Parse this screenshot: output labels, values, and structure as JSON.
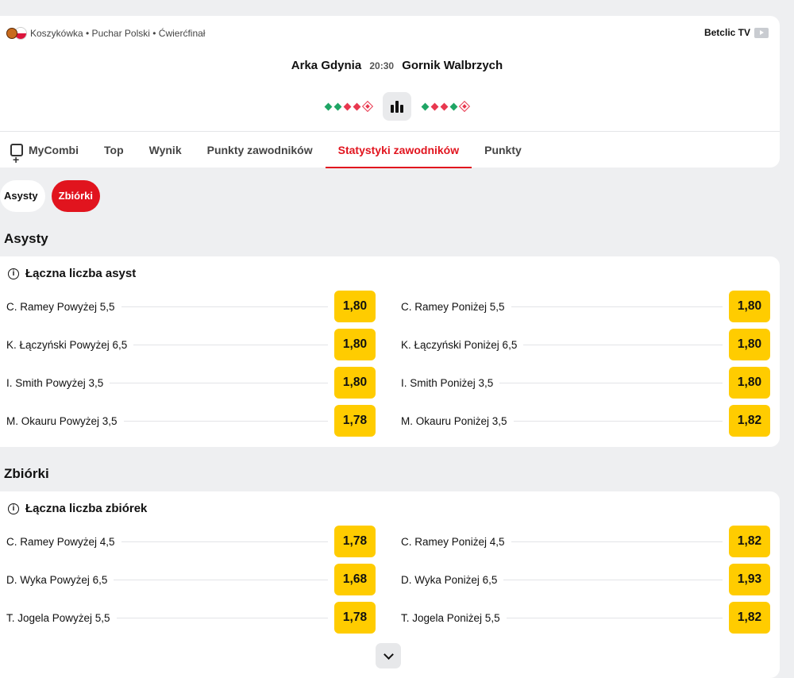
{
  "header": {
    "breadcrumb": "Koszykówka • Puchar Polski • Ćwierćfinał",
    "tv_label": "Betclic TV",
    "home_team": "Arka Gdynia",
    "time": "20:30",
    "away_team": "Gornik Walbrzych",
    "home_form": [
      "win",
      "win",
      "loss",
      "loss",
      "loss"
    ],
    "away_form": [
      "win",
      "loss",
      "loss",
      "win",
      "loss"
    ],
    "colors": {
      "win": "#1fa565",
      "loss": "#e8384f",
      "accent": "#e1141e",
      "odds": "#ffcc00"
    }
  },
  "tabs": [
    {
      "label": "MyCombi",
      "icon": "mycombi-icon"
    },
    {
      "label": "Top"
    },
    {
      "label": "Wynik"
    },
    {
      "label": "Punkty zawodników"
    },
    {
      "label": "Statystyki zawodników",
      "active": true
    },
    {
      "label": "Punkty"
    }
  ],
  "chips": [
    {
      "label": "Asysty",
      "active": false
    },
    {
      "label": "Zbiórki",
      "active": true
    }
  ],
  "sections": [
    {
      "title": "Asysty",
      "market_title": "Łączna liczba asyst",
      "rows": [
        {
          "left": "C. Ramey Powyżej 5,5",
          "left_odd": "1,80",
          "right": "C. Ramey Poniżej 5,5",
          "right_odd": "1,80"
        },
        {
          "left": "K. Łączyński Powyżej 6,5",
          "left_odd": "1,80",
          "right": "K. Łączyński Poniżej 6,5",
          "right_odd": "1,80"
        },
        {
          "left": "I. Smith Powyżej 3,5",
          "left_odd": "1,80",
          "right": "I. Smith Poniżej 3,5",
          "right_odd": "1,80"
        },
        {
          "left": "M. Okauru Powyżej 3,5",
          "left_odd": "1,78",
          "right": "M. Okauru Poniżej 3,5",
          "right_odd": "1,82"
        }
      ]
    },
    {
      "title": "Zbiórki",
      "market_title": "Łączna liczba zbiórek",
      "rows": [
        {
          "left": "C. Ramey Powyżej 4,5",
          "left_odd": "1,78",
          "right": "C. Ramey Poniżej 4,5",
          "right_odd": "1,82"
        },
        {
          "left": "D. Wyka Powyżej 6,5",
          "left_odd": "1,68",
          "right": "D. Wyka Poniżej 6,5",
          "right_odd": "1,93"
        },
        {
          "left": "T. Jogela Powyżej 5,5",
          "left_odd": "1,78",
          "right": "T. Jogela Poniżej 5,5",
          "right_odd": "1,82"
        }
      ]
    }
  ]
}
